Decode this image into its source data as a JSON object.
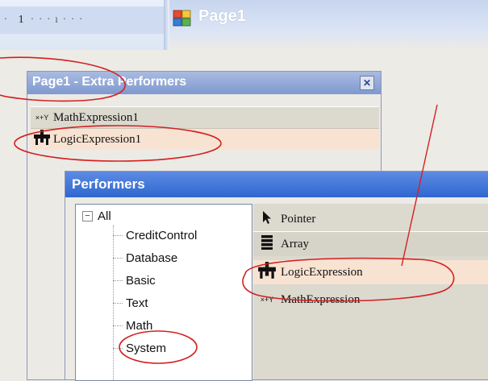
{
  "ruler": {
    "number": "1"
  },
  "page_tab": {
    "title": "Page1"
  },
  "extra_panel": {
    "title": "Page1 - Extra Performers",
    "close_glyph": "✕",
    "items": [
      {
        "icon_text": "×+Y",
        "label": "MathExpression1"
      },
      {
        "icon_text": "",
        "label": "LogicExpression1"
      }
    ]
  },
  "performers_panel": {
    "title": "Performers",
    "tree": {
      "expander": "−",
      "root": "All",
      "children": [
        "CreditControl",
        "Database",
        "Basic",
        "Text",
        "Math",
        "System"
      ]
    },
    "list": [
      {
        "icon": "pointer-icon",
        "label": "Pointer"
      },
      {
        "icon": "array-icon",
        "label": "Array"
      },
      {
        "icon": "logic-expression-icon",
        "label": "LogicExpression"
      },
      {
        "icon": "math-expression-icon",
        "icon_text": "×+Y",
        "label": "MathExpression"
      }
    ]
  },
  "colors": {
    "annotation": "#d42020",
    "title_active": "#2f67d0",
    "title_inactive": "#8fa6d8",
    "selected_row": "#f8e3d2"
  }
}
